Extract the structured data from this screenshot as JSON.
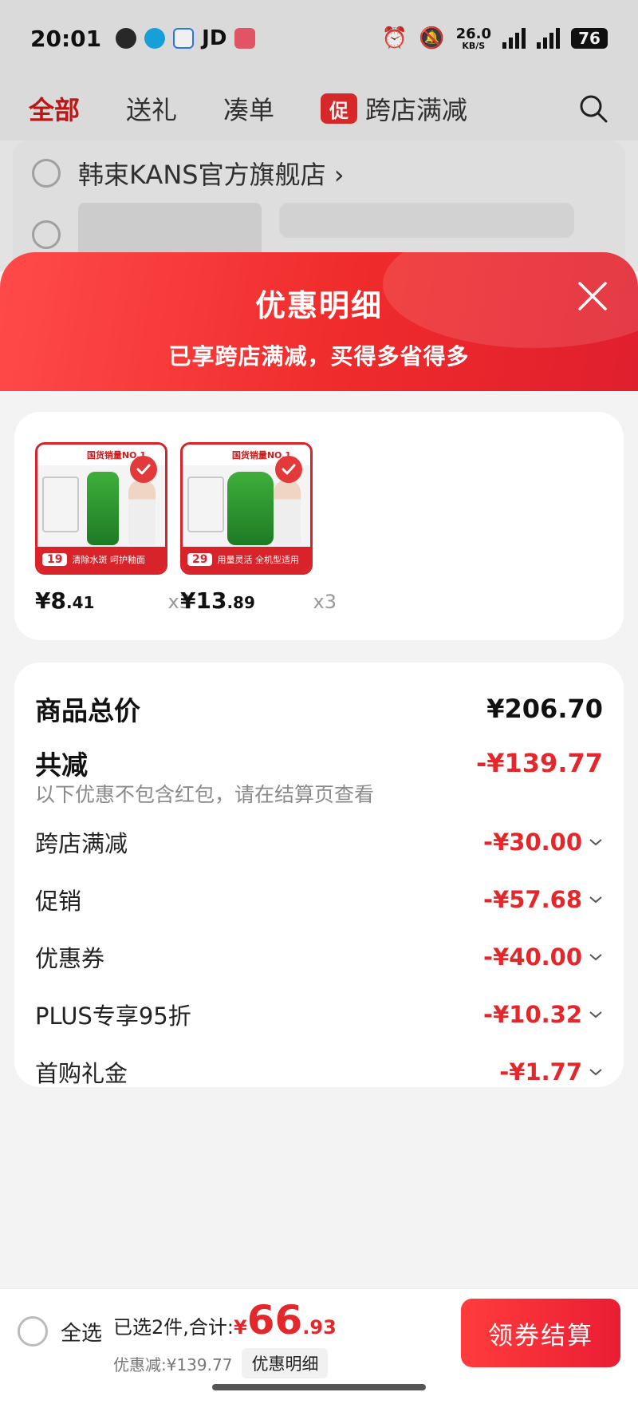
{
  "status_bar": {
    "time": "20:01",
    "apps": [
      "wechat-icon",
      "qq-icon",
      "browser-icon",
      "JD",
      "music-icon"
    ],
    "net_speed": "26.0",
    "net_unit": "KB/S",
    "network": "5G",
    "battery": "76"
  },
  "cart": {
    "tabs": [
      "全部",
      "送礼",
      "凑单",
      "跨店满减"
    ],
    "promo_badge": "促",
    "store_name": "韩束KANS官方旗舰店",
    "store_chevron": "›"
  },
  "sheet": {
    "title": "优惠明细",
    "subtitle": "已享跨店满减，买得多省得多",
    "items": [
      {
        "brand": "国货销量NO.1",
        "badge_price": "19",
        "caption": "清除水斑 呵护釉面",
        "price_int": "¥8",
        "price_dec": ".41",
        "qty": "x3"
      },
      {
        "brand": "国货销量NO.1",
        "badge_price": "29",
        "caption": "用量灵活 全机型适用",
        "price_int": "¥13",
        "price_dec": ".89",
        "qty": "x3"
      }
    ],
    "summary": {
      "total_label": "商品总价",
      "total_value": "¥206.70",
      "reduced_label": "共减",
      "reduced_value": "-¥139.77",
      "note": "以下优惠不包含红包，请在结算页查看",
      "lines": [
        {
          "label": "跨店满减",
          "value": "-¥30.00"
        },
        {
          "label": "促销",
          "value": "-¥57.68"
        },
        {
          "label": "优惠券",
          "value": "-¥40.00"
        },
        {
          "label": "PLUS专享95折",
          "value": "-¥10.32"
        },
        {
          "label": "首购礼金",
          "value": "-¥1.77"
        }
      ]
    }
  },
  "bottom_bar": {
    "select_all": "全选",
    "selected_prefix": "已选2件,合计:",
    "currency": "¥",
    "total_int": "66",
    "total_dec": ".93",
    "discount_text": "优惠减:¥139.77",
    "detail_button": "优惠明细",
    "checkout_button": "领券结算"
  },
  "colors": {
    "accent_red": "#e4272a",
    "header_red": "#ef2b2b",
    "text_dark": "#111111",
    "text_muted": "#8a8a8a"
  }
}
